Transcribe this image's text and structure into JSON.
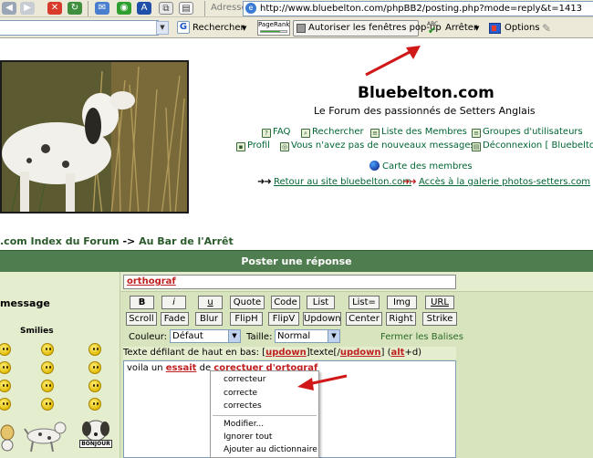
{
  "browser": {
    "address_label": "Adresse",
    "url": "http://www.bluebelton.com/phpBB2/posting.php?mode=reply&t=1413",
    "search_button_label": "Rechercher",
    "pagerank_label": "PageRank",
    "pagerank_level": 0.75,
    "popup_button_label": "Autoriser les fenêtres pop-up",
    "spell_button_icon_text": "ABC",
    "spell_button_label": "Arrêter",
    "options_label": "Options"
  },
  "site": {
    "title": "Bluebelton.com",
    "subtitle": "Le Forum des passionnés de Setters Anglais"
  },
  "nav": {
    "faq": "FAQ",
    "search": "Rechercher",
    "members": "Liste des Membres",
    "groups": "Groupes d'utilisateurs",
    "profile": "Profil",
    "messages": "Vous n'avez pas de nouveaux messages",
    "logout": "Déconnexion [ Bluebelton",
    "map": "Carte des membres",
    "back_link": "Retour au site bluebelton.com",
    "gallery_link": "Accès à la galerie photos-setters.com"
  },
  "breadcrumb": {
    "index": ".com Index du Forum",
    "separator": "->",
    "current": "Au Bar de l'Arrêt"
  },
  "form": {
    "header": "Poster une réponse",
    "subject_value": "orthograf",
    "message_label": "message",
    "smilies_label": "Smilies",
    "buttons_row1": [
      "B",
      "i",
      "u",
      "Quote",
      "Code",
      "List",
      "List=",
      "Img",
      "URL"
    ],
    "buttons_row2": [
      "Scroll",
      "Fade",
      "Blur",
      "FlipH",
      "FlipV",
      "Updown",
      "Center",
      "Right",
      "Strike"
    ],
    "color_label": "Couleur:",
    "color_value": "Défaut",
    "size_label": "Taille:",
    "size_value": "Normal",
    "close_tags_label": "Fermer les Balises",
    "helpline_prefix": "Texte défilant de haut en bas: [",
    "helpline_tag_open": "updown",
    "helpline_mid": "]texte[/",
    "helpline_tag_close": "updown",
    "helpline_suffix": "] (",
    "helpline_shortcut_key": "alt",
    "helpline_shortcut_rest": "+d)",
    "message_words": {
      "w1": "voila un",
      "w2": "essait",
      "w3": "de",
      "w4": "corectuer",
      "w5": "d'ortograf"
    }
  },
  "context_menu": {
    "suggestions": [
      "correcteur",
      "correcte",
      "correctes"
    ],
    "actions": [
      "Modifier...",
      "Ignorer tout",
      "Ajouter au dictionnaire"
    ]
  },
  "bonjour_label": "BONJOUR"
}
